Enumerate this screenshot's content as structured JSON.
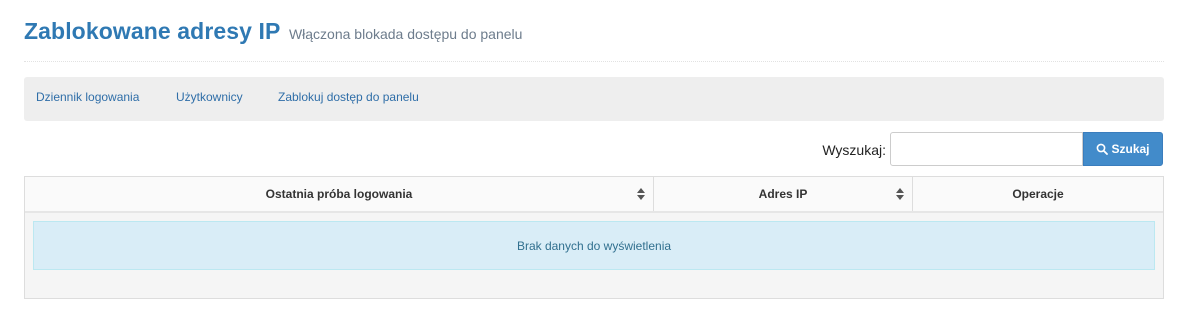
{
  "header": {
    "title": "Zablokowane adresy IP",
    "subtitle": "Włączona blokada dostępu do panelu"
  },
  "nav": {
    "items": [
      {
        "label": "Dziennik logowania"
      },
      {
        "label": "Użytkownicy"
      },
      {
        "label": "Zablokuj dostęp do panelu"
      }
    ]
  },
  "search": {
    "label": "Wyszukaj:",
    "value": "",
    "placeholder": "",
    "button_label": "Szukaj",
    "button_icon": "search-icon"
  },
  "table": {
    "columns": [
      {
        "label": "Ostatnia próba logowania",
        "sortable": true
      },
      {
        "label": "Adres IP",
        "sortable": true
      },
      {
        "label": "Operacje",
        "sortable": false
      }
    ],
    "empty_message": "Brak danych do wyświetlenia"
  },
  "colors": {
    "accent": "#2f79b3",
    "button": "#428bca",
    "info_background": "#d9edf7",
    "info_text": "#31708f"
  }
}
